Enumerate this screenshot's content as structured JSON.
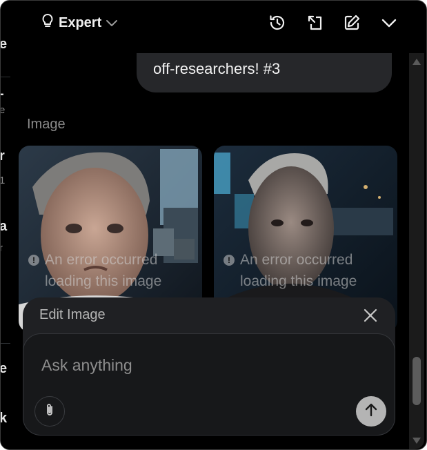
{
  "header": {
    "mode_label": "Expert",
    "icons": [
      "lightbulb-icon",
      "chevron-down-icon",
      "history-icon",
      "pop-out-icon",
      "edit-icon",
      "collapse-icon"
    ]
  },
  "chat": {
    "message_text": "off-researchers! #3",
    "image_section_label": "Image",
    "images": [
      {
        "error_line1": "An error occurred",
        "error_line2": "loading this image"
      },
      {
        "error_line1": "An error occurred",
        "error_line2": "loading this image"
      }
    ]
  },
  "edit_image": {
    "title": "Edit Image",
    "input_placeholder": "Ask anything",
    "input_value": ""
  },
  "colors": {
    "background": "#000000",
    "bubble": "#26272a",
    "panel": "#1f2023",
    "send_button": "#b4b4b4"
  }
}
